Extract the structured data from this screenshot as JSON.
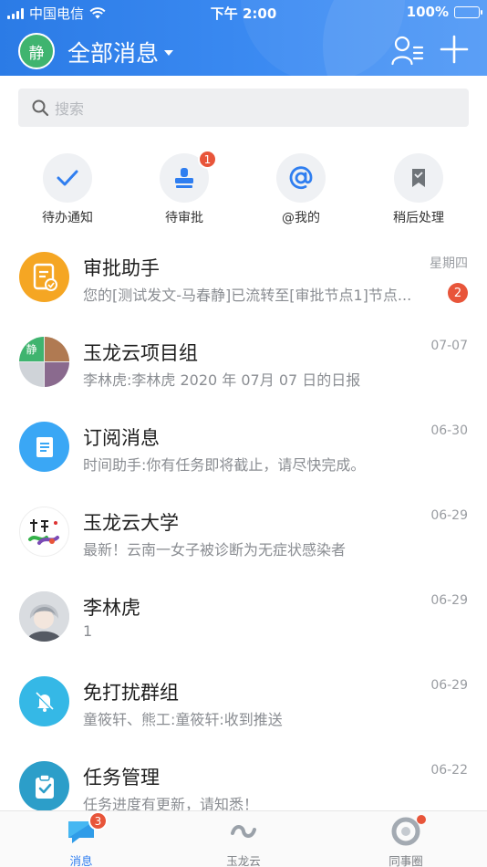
{
  "status_bar": {
    "carrier": "中国电信",
    "time": "下午 2:00",
    "battery": "100%"
  },
  "header": {
    "avatar_text": "静",
    "title": "全部消息"
  },
  "search": {
    "placeholder": "搜索"
  },
  "quick_actions": [
    {
      "label": "待办通知",
      "icon": "check-icon"
    },
    {
      "label": "待审批",
      "icon": "stamp-icon",
      "badge": "1"
    },
    {
      "label": "@我的",
      "icon": "at-icon"
    },
    {
      "label": "稍后处理",
      "icon": "bookmark-icon"
    }
  ],
  "messages": [
    {
      "title": "审批助手",
      "preview": "您的[测试发文-马春静]已流转至[审批节点1]节点...",
      "date": "星期四",
      "badge": "2",
      "avatar": "approval-assistant",
      "color": "#f5a623"
    },
    {
      "title": "玉龙云项目组",
      "preview": "李林虎:李林虎 2020 年 07月 07 日的日报",
      "date": "07-07",
      "avatar": "group-collage"
    },
    {
      "title": "订阅消息",
      "preview": "时间助手:你有任务即将截止，请尽快完成。",
      "date": "06-30",
      "avatar": "subscription",
      "color": "#3aa7f5"
    },
    {
      "title": "玉龙云大学",
      "preview": "最新！云南一女子被诊断为无症状感染者",
      "date": "06-29",
      "avatar": "university-logo"
    },
    {
      "title": "李林虎",
      "preview": "1",
      "date": "06-29",
      "avatar": "person-photo"
    },
    {
      "title": "免打扰群组",
      "preview": "童筱轩、熊工:童筱轩:收到推送",
      "date": "06-29",
      "avatar": "mute-bell",
      "color": "#35b8e6"
    },
    {
      "title": "任务管理",
      "preview": "任务进度有更新，请知悉！",
      "date": "06-22",
      "avatar": "task-clipboard",
      "color": "#2c9ec9"
    }
  ],
  "tabbar": [
    {
      "label": "消息",
      "badge": "3",
      "active": true
    },
    {
      "label": "玉龙云",
      "active": false
    },
    {
      "label": "同事圈",
      "active": false
    }
  ],
  "colors": {
    "primary": "#2f7ef0",
    "badge": "#e8553a"
  }
}
